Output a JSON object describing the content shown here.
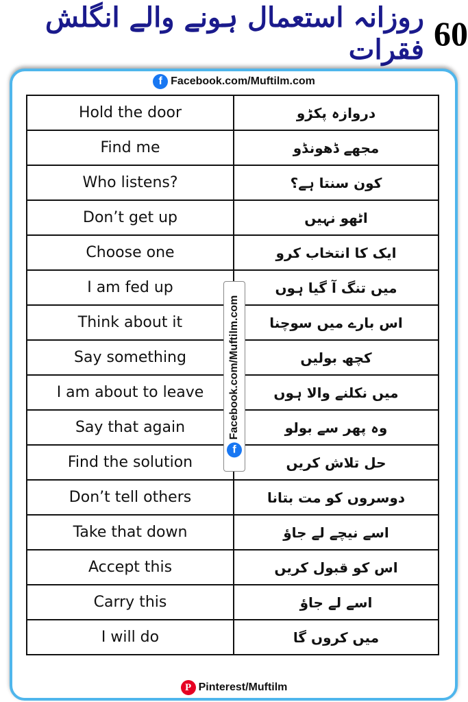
{
  "title": {
    "number": "60",
    "urdu": "روزانہ استعمال ہونے والے انگلش فقرات"
  },
  "facebook_top": {
    "icon": "facebook-icon",
    "text": "Facebook.com/Muftilm.com"
  },
  "watermark": {
    "icon": "facebook-icon",
    "text": "Facebook.com/Muftilm.com"
  },
  "footer": {
    "icon": "pinterest-icon",
    "text": "Pinterest/Muftilm"
  },
  "colors": {
    "title": "#1a1a8c",
    "border": "#4fb6ec",
    "facebook": "#1877f2",
    "pinterest": "#e60023"
  },
  "rows": [
    {
      "en": "Hold the door",
      "ur": "دروازہ پکڑو"
    },
    {
      "en": "Find me",
      "ur": "مجھے ڈھونڈو"
    },
    {
      "en": "Who listens?",
      "ur": "کون سنتا ہے؟"
    },
    {
      "en": "Don’t get up",
      "ur": "اٹھو نہیں"
    },
    {
      "en": "Choose one",
      "ur": "ایک کا انتخاب کرو"
    },
    {
      "en": "I am fed up",
      "ur": "میں تنگ آ گیا ہوں"
    },
    {
      "en": "Think about it",
      "ur": "اس بارے میں سوچنا"
    },
    {
      "en": "Say something",
      "ur": "کچھ بولیں"
    },
    {
      "en": "I am about to leave",
      "ur": "میں نکلنے والا ہوں"
    },
    {
      "en": "Say that again",
      "ur": "وہ پھر سے بولو"
    },
    {
      "en": "Find the solution",
      "ur": "حل تلاش کریں"
    },
    {
      "en": "Don’t tell others",
      "ur": "دوسروں کو مت بتانا"
    },
    {
      "en": "Take that down",
      "ur": "اسے نیچے لے جاؤ"
    },
    {
      "en": "Accept this",
      "ur": "اس کو قبول کریں"
    },
    {
      "en": "Carry this",
      "ur": "اسے لے جاؤ"
    },
    {
      "en": "I will do",
      "ur": "میں کروں گا"
    }
  ]
}
